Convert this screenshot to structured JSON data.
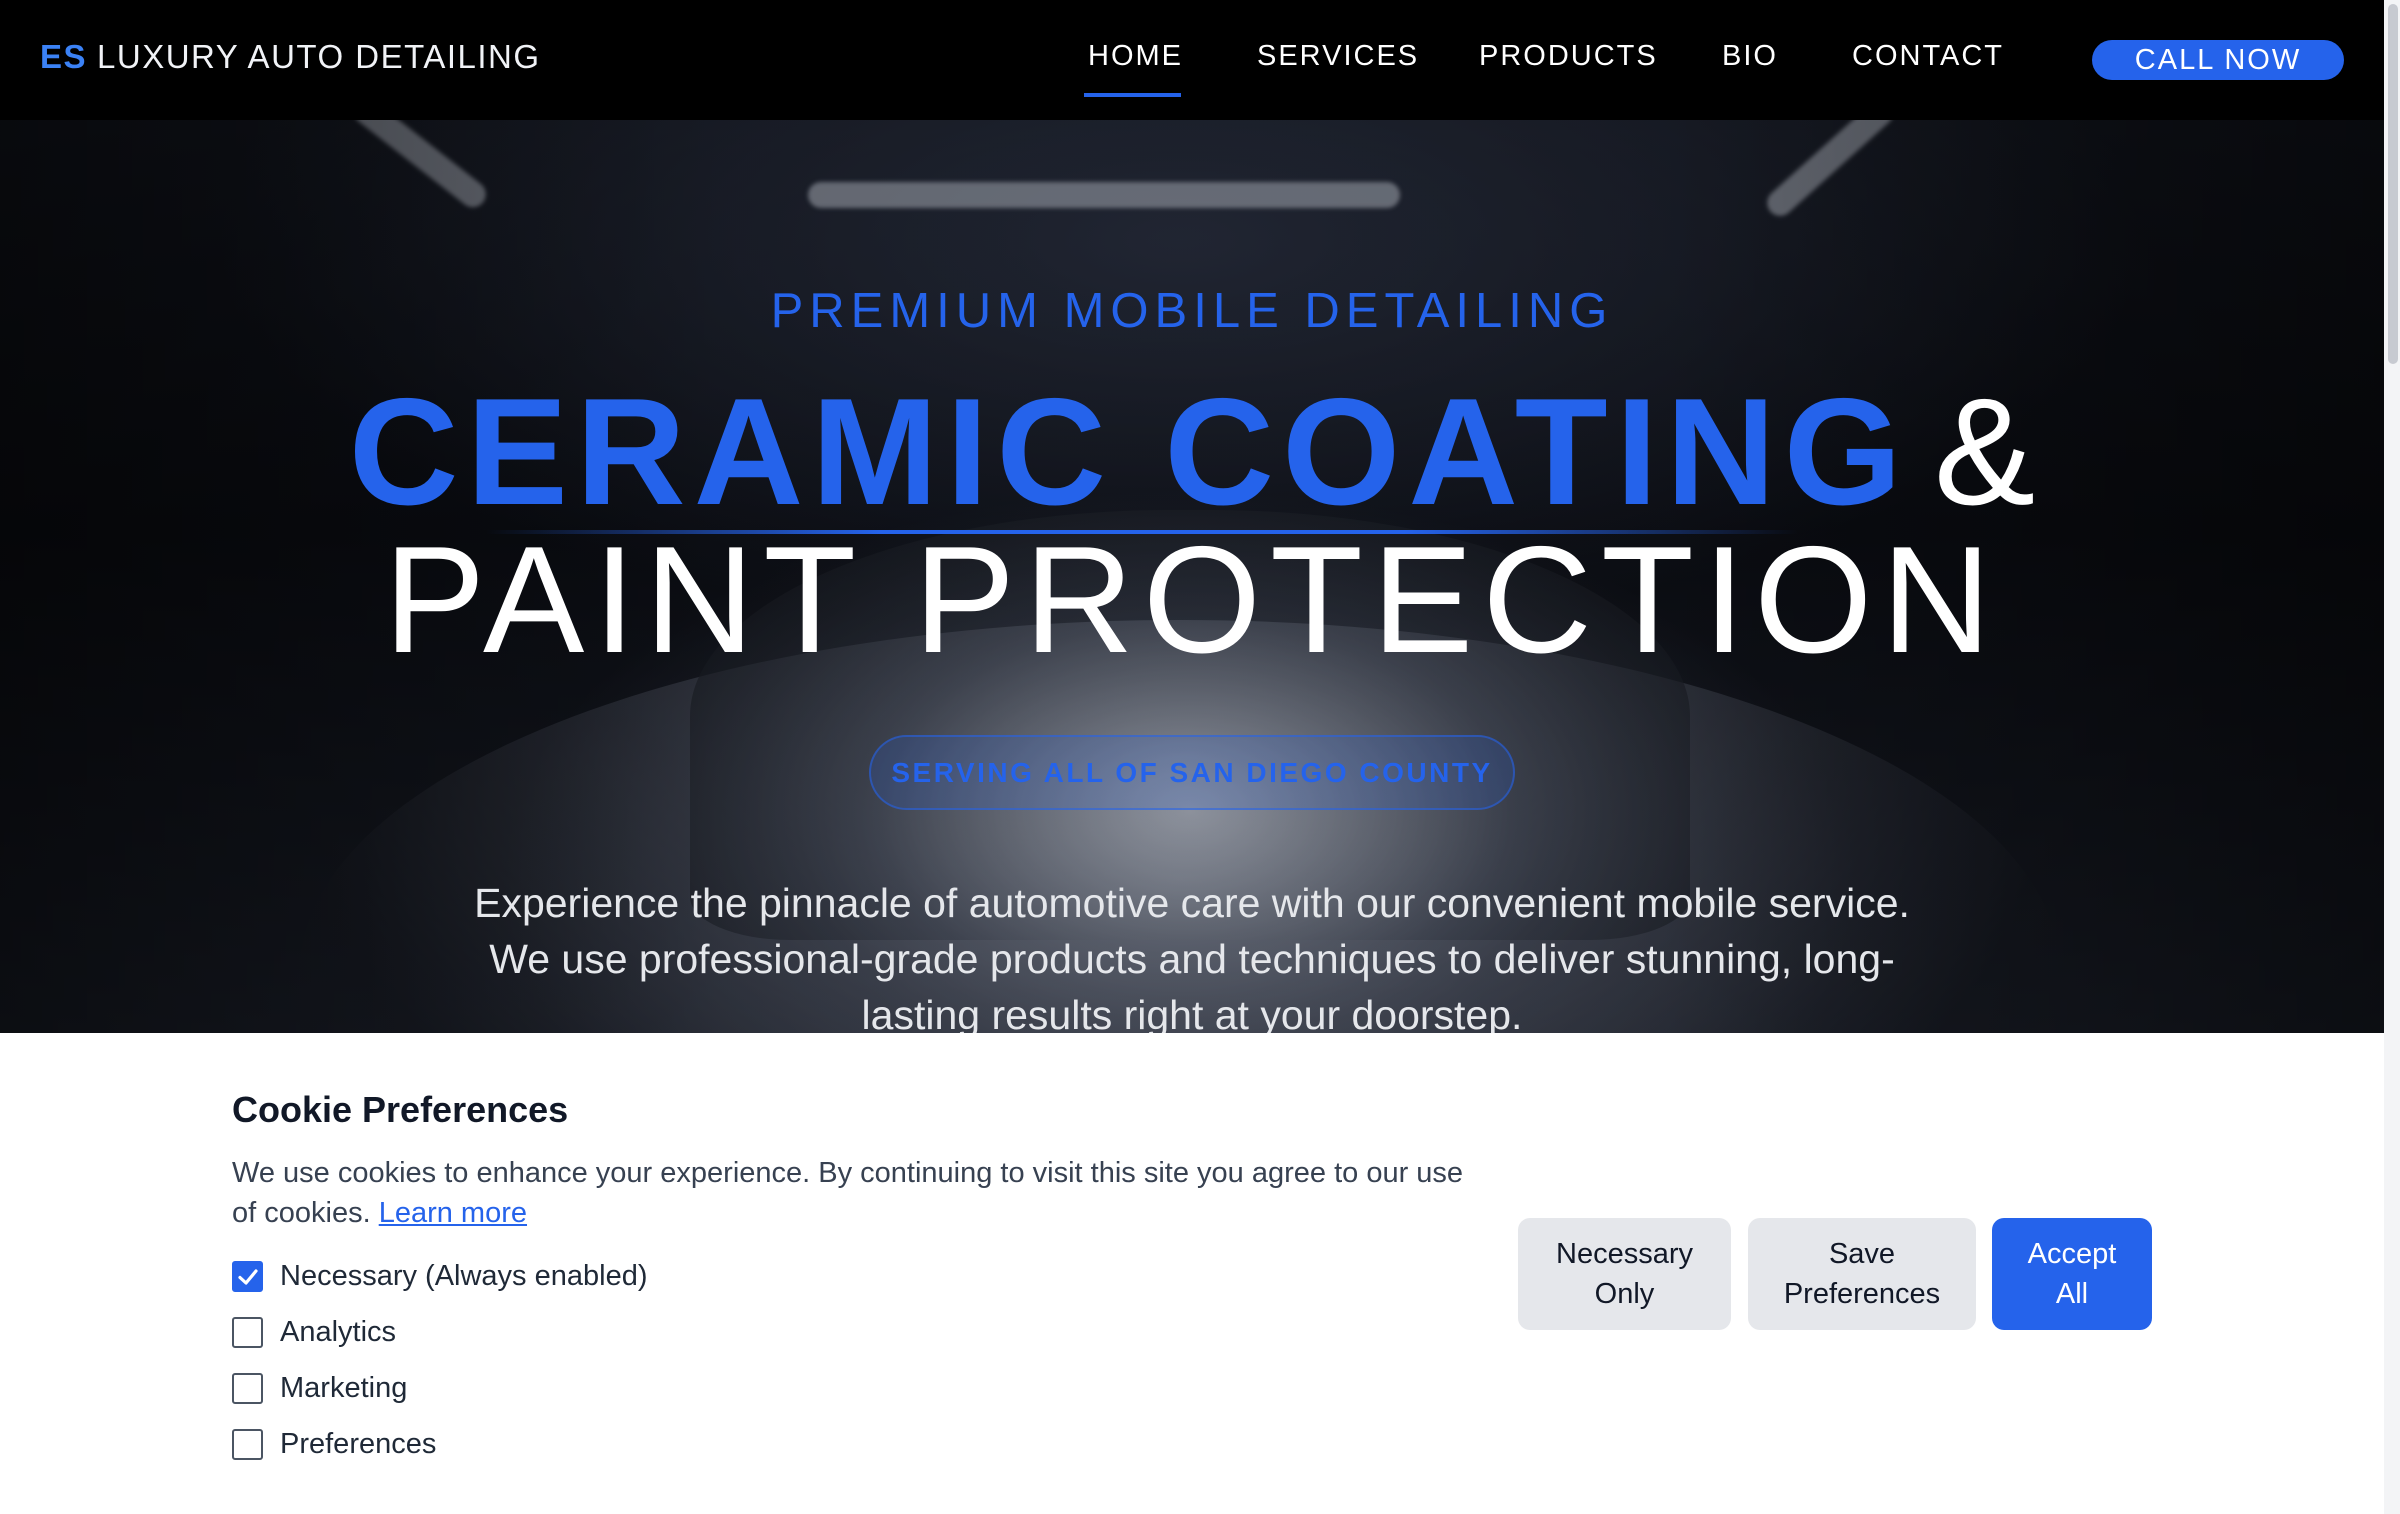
{
  "nav": {
    "brand_short": "ES",
    "brand_name": "LUXURY AUTO DETAILING",
    "links": [
      "HOME",
      "SERVICES",
      "PRODUCTS",
      "BIO",
      "CONTACT"
    ],
    "active": "HOME",
    "cta": "CALL NOW"
  },
  "hero": {
    "kicker": "PREMIUM MOBILE DETAILING",
    "headline_blue": "CERAMIC COATING",
    "headline_amp": "&",
    "headline_line2": "PAINT PROTECTION",
    "pill": "SERVING ALL OF SAN DIEGO COUNTY",
    "body": "Experience the pinnacle of automotive care with our convenient mobile service. We use professional-grade products and techniques to deliver stunning, long-lasting results right at your doorstep."
  },
  "cookie": {
    "title": "Cookie Preferences",
    "text": "We use cookies to enhance your experience. By continuing to visit this site you agree to our use of cookies.",
    "link": "Learn more",
    "options": [
      {
        "label": "Necessary (Always enabled)",
        "checked": true
      },
      {
        "label": "Analytics",
        "checked": false
      },
      {
        "label": "Marketing",
        "checked": false
      },
      {
        "label": "Preferences",
        "checked": false
      }
    ],
    "buttons": {
      "necessary_line1": "Necessary",
      "necessary_line2": "Only",
      "save_line1": "Save",
      "save_line2": "Preferences",
      "accept_line1": "Accept",
      "accept_line2": "All"
    }
  },
  "colors": {
    "accent": "#2563eb",
    "nav_bg": "#000000",
    "banner_bg": "#ffffff"
  }
}
